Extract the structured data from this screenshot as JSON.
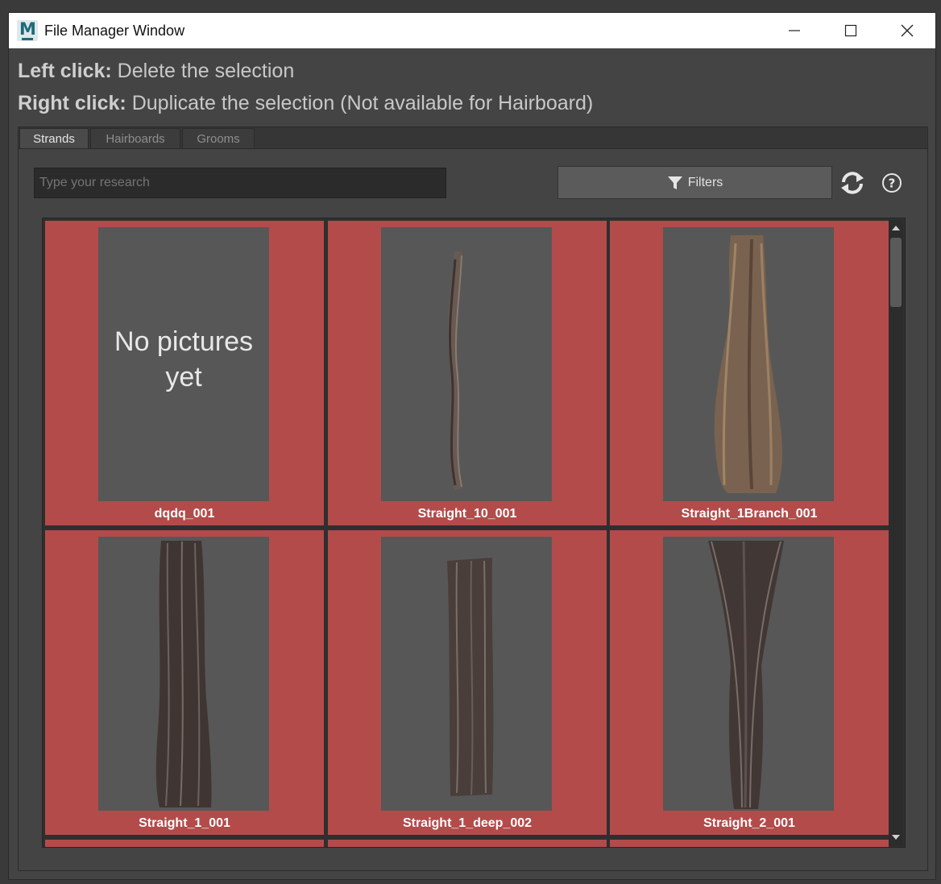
{
  "window": {
    "title": "File Manager Window"
  },
  "instructions": {
    "left_bold": "Left click:",
    "left_text": "Delete the selection",
    "right_bold": "Right click:",
    "right_text": "Duplicate the selection (Not available for Hairboard)"
  },
  "tabs": [
    {
      "label": "Strands",
      "active": true
    },
    {
      "label": "Hairboards",
      "active": false
    },
    {
      "label": "Grooms",
      "active": false
    }
  ],
  "search": {
    "placeholder": "Type your research",
    "value": ""
  },
  "toolbar": {
    "filters_label": "Filters",
    "filter_icon": "funnel-icon",
    "refresh_icon": "refresh-icon",
    "help_icon": "help-icon"
  },
  "colors": {
    "card_selected": "#b34b4b",
    "thumbnail_bg": "#575757"
  },
  "items": [
    {
      "name": "dqdq_001",
      "has_picture": false,
      "placeholder_text_1": "No pictures",
      "placeholder_text_2": "yet"
    },
    {
      "name": "Straight_10_001",
      "has_picture": true
    },
    {
      "name": "Straight_1Branch_001",
      "has_picture": true
    },
    {
      "name": "Straight_1_001",
      "has_picture": true
    },
    {
      "name": "Straight_1_deep_002",
      "has_picture": true
    },
    {
      "name": "Straight_2_001",
      "has_picture": true
    }
  ]
}
